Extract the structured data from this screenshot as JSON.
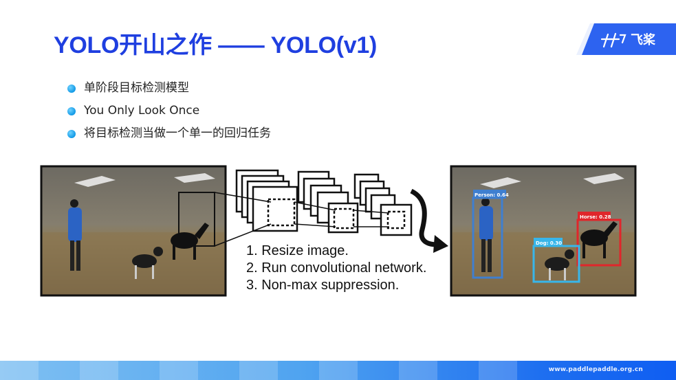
{
  "slide": {
    "title": "YOLO开山之作 —— YOLO(v1)",
    "bullets": [
      "单阶段目标检测模型",
      "You Only Look Once",
      "将目标检测当做一个单一的回归任务"
    ]
  },
  "logo": {
    "text": "飞桨",
    "color": "#2d63f0"
  },
  "pipeline_steps": [
    "1. Resize image.",
    "2. Run convolutional network.",
    "3. Non-max suppression."
  ],
  "detections": [
    {
      "label": "Person: 0.64",
      "color": "#3f7fd0"
    },
    {
      "label": "Horse: 0.28",
      "color": "#e0262b"
    },
    {
      "label": "Dog: 0.30",
      "color": "#38b6ea"
    }
  ],
  "footer": {
    "url": "www.paddlepaddle.org.cn"
  },
  "colors": {
    "accent": "#1f3fe0",
    "bullet": "#1199e6"
  }
}
